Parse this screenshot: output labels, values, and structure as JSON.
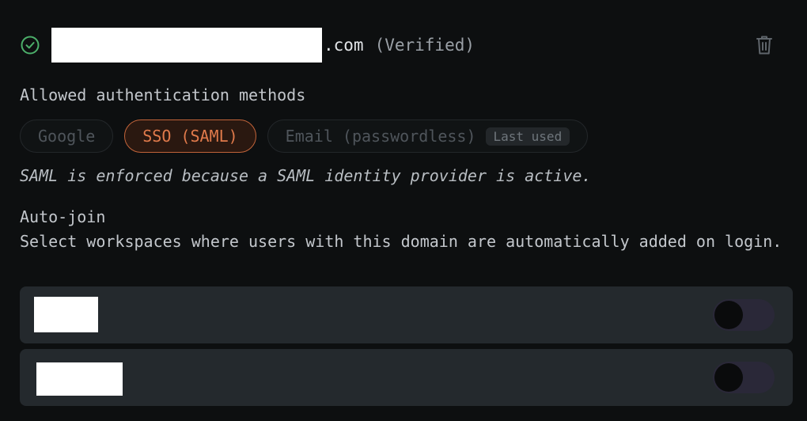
{
  "domain": {
    "suffix": ".com",
    "status": "(Verified)"
  },
  "auth": {
    "heading": "Allowed authentication methods",
    "methods": [
      {
        "label": "Google",
        "active": false
      },
      {
        "label": "SSO (SAML)",
        "active": true
      },
      {
        "label": "Email (passwordless)",
        "active": false,
        "badge": "Last used"
      }
    ],
    "note": "SAML is enforced because a SAML identity provider is active."
  },
  "autojoin": {
    "heading": "Auto-join",
    "description": "Select workspaces where users with this domain are automatically added on login."
  },
  "workspaces": [
    {
      "enabled": false
    },
    {
      "enabled": false
    }
  ],
  "colors": {
    "verified_check": "#4caf6a",
    "active_method": "#e07a4b",
    "toggle_track": "#2a2838"
  },
  "icons": {
    "status": "check-circle-icon",
    "delete": "trash-icon"
  }
}
